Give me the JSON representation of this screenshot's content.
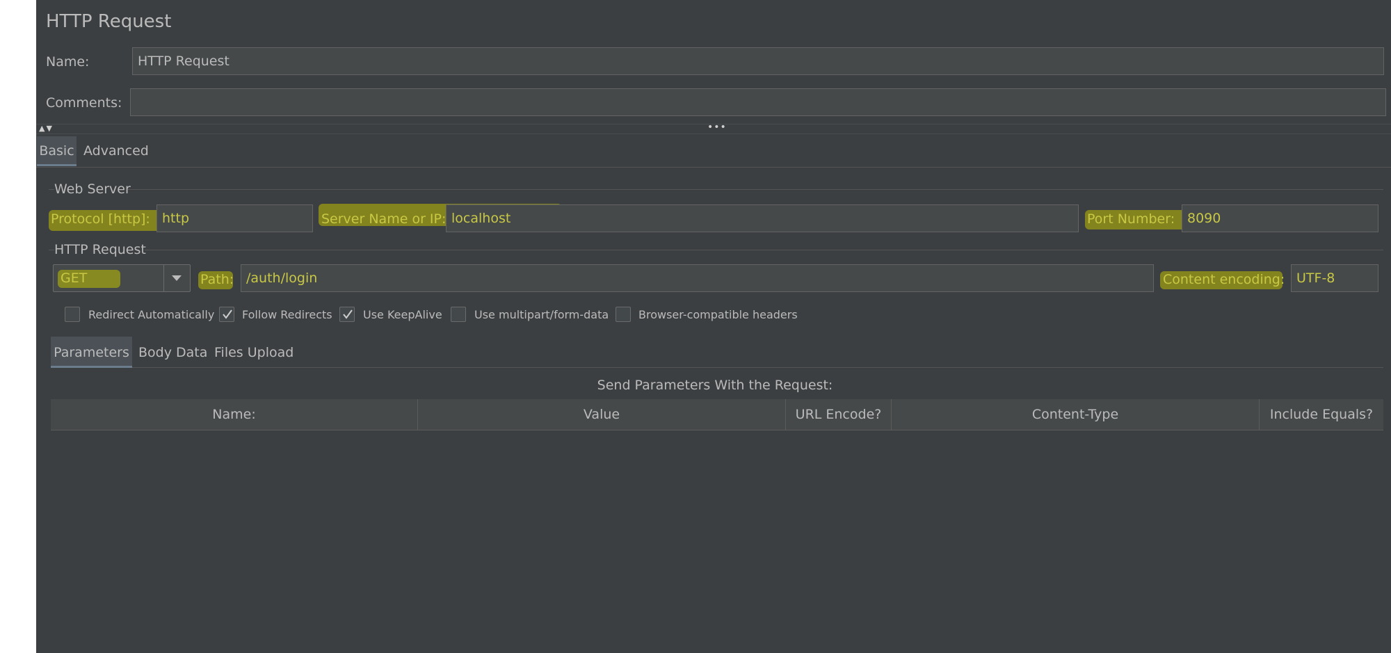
{
  "title": "HTTP Request",
  "name_label": "Name:",
  "name_value": "HTTP Request",
  "comments_label": "Comments:",
  "comments_value": "",
  "splitter_arrows": "▲▼",
  "splitter_dots": "•••",
  "tabs": [
    {
      "label": "Basic",
      "selected": true
    },
    {
      "label": "Advanced",
      "selected": false
    }
  ],
  "web_server": {
    "section_title": "Web Server",
    "protocol_label": "Protocol [http]:",
    "protocol_value": "http",
    "server_label": "Server Name or IP:",
    "server_value": "localhost",
    "port_label": "Port Number:",
    "port_value": "8090"
  },
  "http_request": {
    "section_title": "HTTP Request",
    "method_value": "GET",
    "path_label": "Path:",
    "path_value": "/auth/login",
    "encoding_label": "Content encoding:",
    "encoding_value": "UTF-8"
  },
  "checkboxes": [
    {
      "label": "Redirect Automatically",
      "checked": false
    },
    {
      "label": "Follow Redirects",
      "checked": true
    },
    {
      "label": "Use KeepAlive",
      "checked": true
    },
    {
      "label": "Use multipart/form-data",
      "checked": false
    },
    {
      "label": "Browser-compatible headers",
      "checked": false
    }
  ],
  "sub_tabs": [
    {
      "label": "Parameters",
      "selected": true
    },
    {
      "label": "Body Data",
      "selected": false
    },
    {
      "label": "Files Upload",
      "selected": false
    }
  ],
  "params_title": "Send Parameters With the Request:",
  "params_columns": [
    "Name:",
    "Value",
    "URL Encode?",
    "Content-Type",
    "Include Equals?"
  ],
  "colors": {
    "panel_bg": "#3c3f41",
    "field_bg": "#45494a",
    "highlight": "#bebe00",
    "text": "#bbbbbb"
  }
}
